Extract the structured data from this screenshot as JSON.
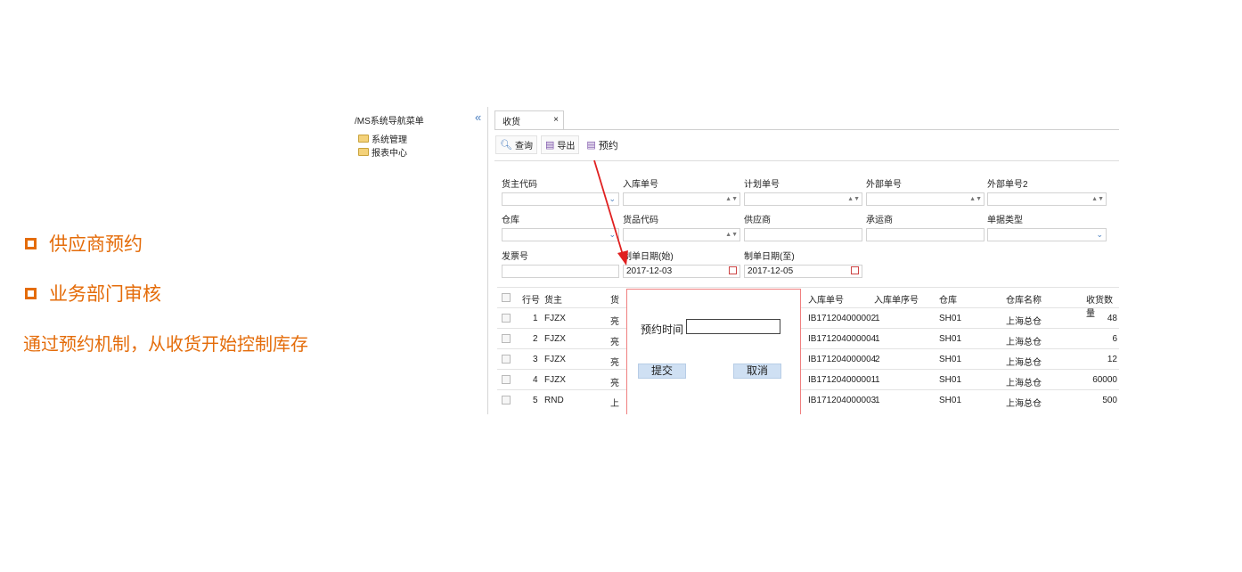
{
  "slide": {
    "bullets": [
      "供应商预约",
      "业务部门审核"
    ],
    "description": "通过预约机制，从收货开始控制库存"
  },
  "app": {
    "sidebar": {
      "title": "/MS系统导航菜单",
      "collapse_icon": "«",
      "items": [
        "系统管理",
        "报表中心"
      ]
    },
    "tab": {
      "label": "收货",
      "close": "×"
    },
    "toolbar": {
      "query": "查询",
      "export": "导出",
      "reserve": "预约"
    },
    "form": {
      "labels": {
        "owner_code": "货主代码",
        "inbound_no": "入库单号",
        "plan_no": "计划单号",
        "external_no": "外部单号",
        "external_no2": "外部单号2",
        "warehouse": "仓库",
        "item_code": "货品代码",
        "supplier": "供应商",
        "carrier": "承运商",
        "doc_type": "单据类型",
        "invoice_no": "发票号",
        "date_start": "制单日期(始)",
        "date_end": "制单日期(至)"
      },
      "values": {
        "date_start": "2017-12-03",
        "date_end": "2017-12-05"
      }
    },
    "table": {
      "headers": {
        "row_no": "行号",
        "owner": "货主",
        "item": "货",
        "inbound_no": "入库单号",
        "inbound_seq": "入库单序号",
        "warehouse": "仓库",
        "warehouse_name": "仓库名称",
        "received_qty": "收货数量"
      },
      "rows": [
        {
          "row_no": "1",
          "owner": "FJZX",
          "item": "亮",
          "inbound_no": "IB171204000002",
          "seq": "1",
          "warehouse": "SH01",
          "warehouse_name": "上海总仓",
          "qty": "48"
        },
        {
          "row_no": "2",
          "owner": "FJZX",
          "item": "亮",
          "inbound_no": "IB171204000004",
          "seq": "1",
          "warehouse": "SH01",
          "warehouse_name": "上海总仓",
          "qty": "6"
        },
        {
          "row_no": "3",
          "owner": "FJZX",
          "item": "亮",
          "inbound_no": "IB171204000004",
          "seq": "2",
          "warehouse": "SH01",
          "warehouse_name": "上海总仓",
          "qty": "12"
        },
        {
          "row_no": "4",
          "owner": "FJZX",
          "item": "亮",
          "inbound_no": "IB171204000001",
          "seq": "1",
          "warehouse": "SH01",
          "warehouse_name": "上海总仓",
          "qty": "60000"
        },
        {
          "row_no": "5",
          "owner": "RND",
          "item": "上",
          "inbound_no": "IB171204000003",
          "seq": "1",
          "warehouse": "SH01",
          "warehouse_name": "上海总仓",
          "qty": "500"
        }
      ]
    },
    "dialog": {
      "label": "预约时间",
      "submit": "提交",
      "cancel": "取消"
    }
  },
  "colors": {
    "accent_orange": "#E46C0A",
    "annotation_red": "#E02020",
    "dialog_border": "#F08080",
    "button_blue": "#CFE0F3"
  }
}
